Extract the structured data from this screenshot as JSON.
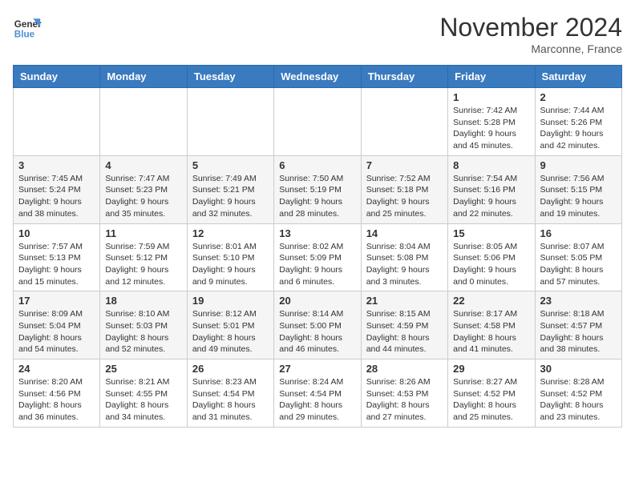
{
  "logo": {
    "line1": "General",
    "line2": "Blue"
  },
  "title": "November 2024",
  "location": "Marconne, France",
  "days_header": [
    "Sunday",
    "Monday",
    "Tuesday",
    "Wednesday",
    "Thursday",
    "Friday",
    "Saturday"
  ],
  "weeks": [
    [
      {
        "day": "",
        "info": ""
      },
      {
        "day": "",
        "info": ""
      },
      {
        "day": "",
        "info": ""
      },
      {
        "day": "",
        "info": ""
      },
      {
        "day": "",
        "info": ""
      },
      {
        "day": "1",
        "info": "Sunrise: 7:42 AM\nSunset: 5:28 PM\nDaylight: 9 hours and 45 minutes."
      },
      {
        "day": "2",
        "info": "Sunrise: 7:44 AM\nSunset: 5:26 PM\nDaylight: 9 hours and 42 minutes."
      }
    ],
    [
      {
        "day": "3",
        "info": "Sunrise: 7:45 AM\nSunset: 5:24 PM\nDaylight: 9 hours and 38 minutes."
      },
      {
        "day": "4",
        "info": "Sunrise: 7:47 AM\nSunset: 5:23 PM\nDaylight: 9 hours and 35 minutes."
      },
      {
        "day": "5",
        "info": "Sunrise: 7:49 AM\nSunset: 5:21 PM\nDaylight: 9 hours and 32 minutes."
      },
      {
        "day": "6",
        "info": "Sunrise: 7:50 AM\nSunset: 5:19 PM\nDaylight: 9 hours and 28 minutes."
      },
      {
        "day": "7",
        "info": "Sunrise: 7:52 AM\nSunset: 5:18 PM\nDaylight: 9 hours and 25 minutes."
      },
      {
        "day": "8",
        "info": "Sunrise: 7:54 AM\nSunset: 5:16 PM\nDaylight: 9 hours and 22 minutes."
      },
      {
        "day": "9",
        "info": "Sunrise: 7:56 AM\nSunset: 5:15 PM\nDaylight: 9 hours and 19 minutes."
      }
    ],
    [
      {
        "day": "10",
        "info": "Sunrise: 7:57 AM\nSunset: 5:13 PM\nDaylight: 9 hours and 15 minutes."
      },
      {
        "day": "11",
        "info": "Sunrise: 7:59 AM\nSunset: 5:12 PM\nDaylight: 9 hours and 12 minutes."
      },
      {
        "day": "12",
        "info": "Sunrise: 8:01 AM\nSunset: 5:10 PM\nDaylight: 9 hours and 9 minutes."
      },
      {
        "day": "13",
        "info": "Sunrise: 8:02 AM\nSunset: 5:09 PM\nDaylight: 9 hours and 6 minutes."
      },
      {
        "day": "14",
        "info": "Sunrise: 8:04 AM\nSunset: 5:08 PM\nDaylight: 9 hours and 3 minutes."
      },
      {
        "day": "15",
        "info": "Sunrise: 8:05 AM\nSunset: 5:06 PM\nDaylight: 9 hours and 0 minutes."
      },
      {
        "day": "16",
        "info": "Sunrise: 8:07 AM\nSunset: 5:05 PM\nDaylight: 8 hours and 57 minutes."
      }
    ],
    [
      {
        "day": "17",
        "info": "Sunrise: 8:09 AM\nSunset: 5:04 PM\nDaylight: 8 hours and 54 minutes."
      },
      {
        "day": "18",
        "info": "Sunrise: 8:10 AM\nSunset: 5:03 PM\nDaylight: 8 hours and 52 minutes."
      },
      {
        "day": "19",
        "info": "Sunrise: 8:12 AM\nSunset: 5:01 PM\nDaylight: 8 hours and 49 minutes."
      },
      {
        "day": "20",
        "info": "Sunrise: 8:14 AM\nSunset: 5:00 PM\nDaylight: 8 hours and 46 minutes."
      },
      {
        "day": "21",
        "info": "Sunrise: 8:15 AM\nSunset: 4:59 PM\nDaylight: 8 hours and 44 minutes."
      },
      {
        "day": "22",
        "info": "Sunrise: 8:17 AM\nSunset: 4:58 PM\nDaylight: 8 hours and 41 minutes."
      },
      {
        "day": "23",
        "info": "Sunrise: 8:18 AM\nSunset: 4:57 PM\nDaylight: 8 hours and 38 minutes."
      }
    ],
    [
      {
        "day": "24",
        "info": "Sunrise: 8:20 AM\nSunset: 4:56 PM\nDaylight: 8 hours and 36 minutes."
      },
      {
        "day": "25",
        "info": "Sunrise: 8:21 AM\nSunset: 4:55 PM\nDaylight: 8 hours and 34 minutes."
      },
      {
        "day": "26",
        "info": "Sunrise: 8:23 AM\nSunset: 4:54 PM\nDaylight: 8 hours and 31 minutes."
      },
      {
        "day": "27",
        "info": "Sunrise: 8:24 AM\nSunset: 4:54 PM\nDaylight: 8 hours and 29 minutes."
      },
      {
        "day": "28",
        "info": "Sunrise: 8:26 AM\nSunset: 4:53 PM\nDaylight: 8 hours and 27 minutes."
      },
      {
        "day": "29",
        "info": "Sunrise: 8:27 AM\nSunset: 4:52 PM\nDaylight: 8 hours and 25 minutes."
      },
      {
        "day": "30",
        "info": "Sunrise: 8:28 AM\nSunset: 4:52 PM\nDaylight: 8 hours and 23 minutes."
      }
    ]
  ]
}
